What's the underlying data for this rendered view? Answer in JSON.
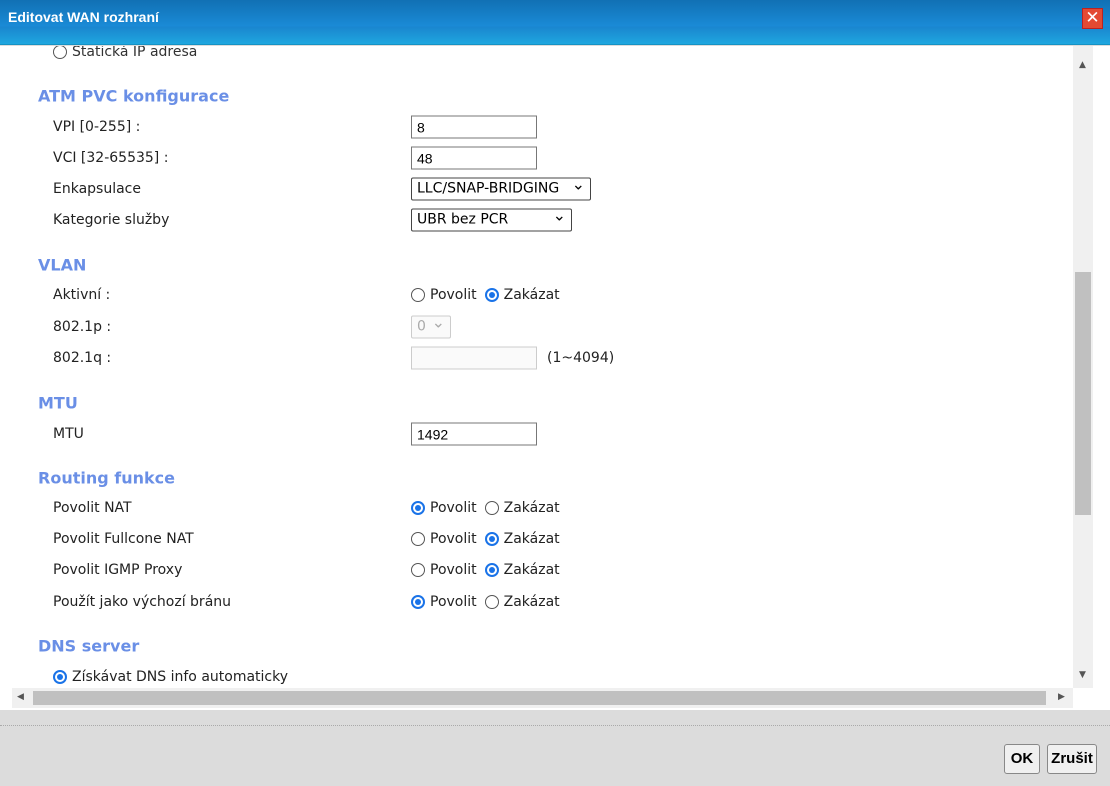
{
  "window": {
    "title": "Editovat WAN rozhraní"
  },
  "partial_option": "Statická IP adresa",
  "atm": {
    "heading": "ATM PVC konfigurace",
    "vpi_label": "VPI [0-255] :",
    "vpi": "8",
    "vci_label": "VCI [32-65535] :",
    "vci": "48",
    "encap_label": "Enkapsulace",
    "encap": "LLC/SNAP-BRIDGING",
    "service_label": "Kategorie služby",
    "service": "UBR bez PCR"
  },
  "vlan": {
    "heading": "VLAN",
    "active_label": "Aktivní :",
    "p_label": "802.1p :",
    "p_value": "0",
    "q_label": "802.1q :",
    "q_value": "",
    "q_hint": "(1~4094)"
  },
  "mtu": {
    "heading": "MTU",
    "label": "MTU",
    "value": "1492"
  },
  "routing": {
    "heading": "Routing funkce",
    "rows": [
      {
        "label": "Povolit NAT",
        "selected": "Povolit"
      },
      {
        "label": "Povolit Fullcone NAT",
        "selected": "Zakázat"
      },
      {
        "label": "Povolit IGMP Proxy",
        "selected": "Zakázat"
      },
      {
        "label": "Použít jako výchozí bránu",
        "selected": "Povolit"
      }
    ]
  },
  "options": {
    "enable": "Povolit",
    "disable": "Zakázat"
  },
  "dns": {
    "heading": "DNS server",
    "auto": "Získávat DNS info automaticky"
  },
  "buttons": {
    "ok": "OK",
    "cancel": "Zrušit"
  }
}
